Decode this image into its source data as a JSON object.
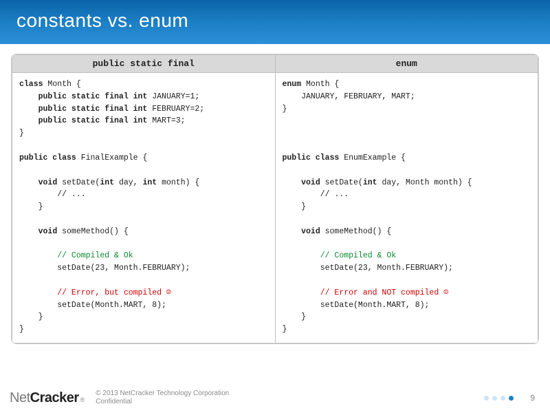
{
  "slide": {
    "title": "constants vs. enum",
    "table": {
      "headers": {
        "left": "public static final",
        "right": "enum"
      },
      "left_tokens": [
        [
          "kw",
          "class"
        ],
        [
          "",
          " Month {\n"
        ],
        [
          "",
          "    "
        ],
        [
          "kw",
          "public static final int"
        ],
        [
          "",
          " JANUARY=1;\n"
        ],
        [
          "",
          "    "
        ],
        [
          "kw",
          "public static final int"
        ],
        [
          "",
          " FEBRUARY=2;\n"
        ],
        [
          "",
          "    "
        ],
        [
          "kw",
          "public static final int"
        ],
        [
          "",
          " MART=3;\n"
        ],
        [
          "",
          "}\n"
        ],
        [
          "",
          "\n"
        ],
        [
          "kw",
          "public class"
        ],
        [
          "",
          " FinalExample {\n"
        ],
        [
          "",
          "\n"
        ],
        [
          "",
          "    "
        ],
        [
          "kw",
          "void"
        ],
        [
          "",
          " setDate("
        ],
        [
          "kw",
          "int"
        ],
        [
          "",
          " day, "
        ],
        [
          "kw",
          "int"
        ],
        [
          "",
          " month) {\n"
        ],
        [
          "",
          "        // ...\n"
        ],
        [
          "",
          "    }\n"
        ],
        [
          "",
          "\n"
        ],
        [
          "",
          "    "
        ],
        [
          "kw",
          "void"
        ],
        [
          "",
          " someMethod() {\n"
        ],
        [
          "",
          "\n"
        ],
        [
          "cm-ok",
          "        // Compiled & Ok\n"
        ],
        [
          "",
          "        setDate(23, Month.FEBRUARY);\n"
        ],
        [
          "",
          "\n"
        ],
        [
          "cm-err",
          "        // Error, but compiled ☹\n"
        ],
        [
          "",
          "        setDate(Month.MART, 8);\n"
        ],
        [
          "",
          "    }\n"
        ],
        [
          "",
          "}"
        ]
      ],
      "right_tokens": [
        [
          "kw",
          "enum"
        ],
        [
          "",
          " Month {\n"
        ],
        [
          "",
          "    JANUARY, FEBRUARY, MART;\n"
        ],
        [
          "",
          "}\n"
        ],
        [
          "",
          "\n"
        ],
        [
          "",
          "\n"
        ],
        [
          "",
          "\n"
        ],
        [
          "kw",
          "public class"
        ],
        [
          "",
          " EnumExample {\n"
        ],
        [
          "",
          "\n"
        ],
        [
          "",
          "    "
        ],
        [
          "kw",
          "void"
        ],
        [
          "",
          " setDate("
        ],
        [
          "kw",
          "int"
        ],
        [
          "",
          " day, Month month) {\n"
        ],
        [
          "",
          "        // ...\n"
        ],
        [
          "",
          "    }\n"
        ],
        [
          "",
          "\n"
        ],
        [
          "",
          "    "
        ],
        [
          "kw",
          "void"
        ],
        [
          "",
          " someMethod() {\n"
        ],
        [
          "",
          "\n"
        ],
        [
          "cm-ok",
          "        // Compiled & Ok\n"
        ],
        [
          "",
          "        setDate(23, Month.FEBRUARY);\n"
        ],
        [
          "",
          "\n"
        ],
        [
          "cm-err",
          "        // Error and NOT compiled ☹\n"
        ],
        [
          "",
          "        setDate(Month.MART, 8);\n"
        ],
        [
          "",
          "    }\n"
        ],
        [
          "",
          "}"
        ]
      ]
    }
  },
  "footer": {
    "logo": {
      "part1": "Net",
      "part2": "Cracker",
      "reg": "®"
    },
    "copyright_line1": "© 2013 NetCracker Technology Corporation",
    "copyright_line2": "Confidential",
    "page_number": "9"
  }
}
